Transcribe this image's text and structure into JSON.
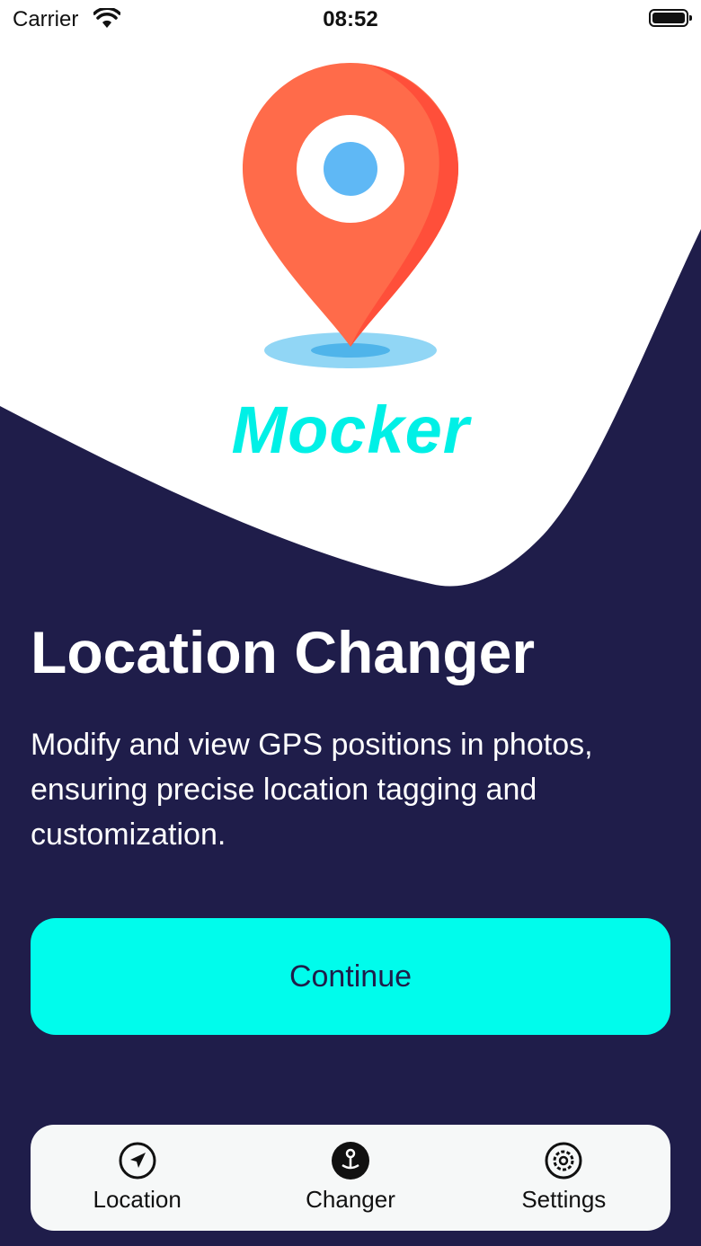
{
  "status_bar": {
    "carrier": "Carrier",
    "time": "08:52"
  },
  "colors": {
    "background": "#1f1d4a",
    "accent": "#00fcec",
    "logo_text": "#00f0e6",
    "pin": "#ff6b4a",
    "pin_dot": "#5fb8f5"
  },
  "logo": {
    "text": "Mocker",
    "icon": "map-pin-icon"
  },
  "hero": {
    "title": "Location Changer",
    "description": "Modify and view GPS positions in photos, ensuring precise location tagging and customization."
  },
  "continue_label": "Continue",
  "tabs": [
    {
      "label": "Location",
      "icon": "navigation-arrow-icon"
    },
    {
      "label": "Changer",
      "icon": "pin-drop-icon"
    },
    {
      "label": "Settings",
      "icon": "gear-icon"
    }
  ]
}
